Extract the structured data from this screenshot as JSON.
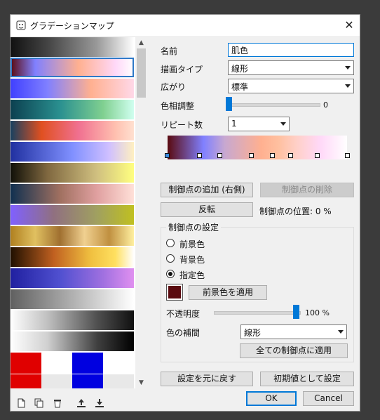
{
  "window": {
    "title": "グラデーションマップ"
  },
  "form": {
    "name_label": "名前",
    "name_value": "肌色",
    "draw_type_label": "描画タイプ",
    "draw_type_value": "線形",
    "spread_label": "広がり",
    "spread_value": "標準",
    "hue_label": "色相調整",
    "hue_value": "0",
    "repeat_label": "リピート数",
    "repeat_value": "1"
  },
  "buttons": {
    "add_stop": "制御点の追加 (右側)",
    "delete_stop": "制御点の削除",
    "reverse": "反転",
    "reset": "設定を元に戻す",
    "set_default": "初期値として設定",
    "ok": "OK",
    "cancel": "Cancel",
    "apply_foreground": "前景色を適用",
    "apply_all": "全ての制御点に適用"
  },
  "stop_position_label": "制御点の位置: 0 %",
  "stop_settings": {
    "title": "制御点の設定",
    "radio_foreground": "前景色",
    "radio_background": "背景色",
    "radio_specified": "指定色",
    "selected_radio": "specified",
    "color": "#5a0a0f",
    "opacity_label": "不透明度",
    "opacity_value": "100 %",
    "interp_label": "色の補間",
    "interp_value": "線形"
  },
  "colors": {
    "accent": "#0078d7",
    "selected_outline": "#2e78c7"
  },
  "icons": [
    "new-icon",
    "duplicate-icon",
    "delete-icon",
    "import-icon",
    "export-icon",
    "close-icon"
  ]
}
